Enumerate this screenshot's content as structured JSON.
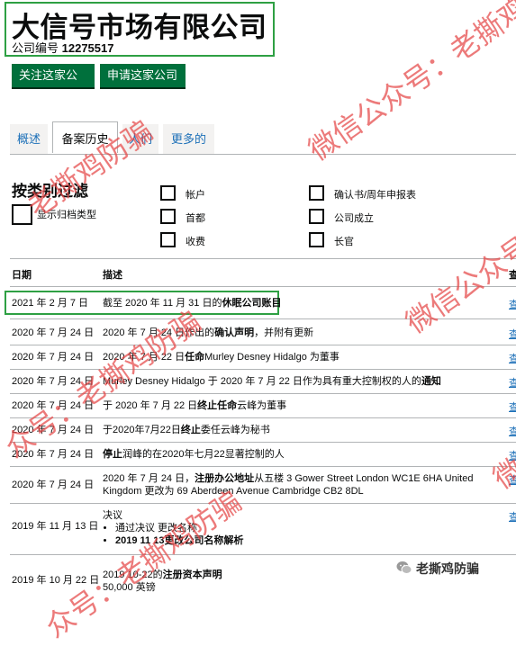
{
  "company": {
    "name": "大信号市场有限公司",
    "number_label": "公司编号",
    "number": "12275517"
  },
  "actions": {
    "follow": "关注这家公司",
    "apply": "申请这家公司"
  },
  "tabs": [
    "概述",
    "备案历史",
    "人们",
    "更多的"
  ],
  "filter": {
    "title": "按类别过滤",
    "show_filing_types": "显示归档类型",
    "options": [
      "帐户",
      "首都",
      "收费",
      "确认书/周年申报表",
      "公司成立",
      "长官"
    ]
  },
  "table": {
    "headers": [
      "日期",
      "描述"
    ],
    "rows": [
      {
        "date": "2021 年 2 月 7 日",
        "pre": "截至 2020 年 11 月 31 日的",
        "bold": "休眠公司账目",
        "post": ""
      },
      {
        "date": "2020 年 7 月 24 日",
        "pre": "2020 年 7 月 24 日作出的",
        "bold": "确认声明",
        "post": "，并附有更新"
      },
      {
        "date": "2020 年 7 月 24 日",
        "pre": "2020 年 7 月 22 日",
        "bold": "任命",
        "post": "Murley Desney Hidalgo 为董事"
      },
      {
        "date": "2020 年 7 月 24 日",
        "pre": "Murley Desney Hidalgo 于 2020 年 7 月 22 日作为具有重大控制权的人的",
        "bold": "通知",
        "post": ""
      },
      {
        "date": "2020 年 7 月 24 日",
        "pre": "于 2020 年 7 月 22 日",
        "bold": "终止任命",
        "post": "云峰为董事"
      },
      {
        "date": "2020 年 7 月 24 日",
        "pre": "于2020年7月22日",
        "bold": "终止",
        "post": "委任云峰为秘书"
      },
      {
        "date": "2020 年 7 月 24 日",
        "pre": "",
        "bold": "停止",
        "post": "润峰的在2020年七月22显著控制的人"
      },
      {
        "date": "2020 年 7 月 24 日",
        "pre": "2020 年 7 月 24 日，",
        "bold": "注册办公地址",
        "post": "从五楼 3 Gower Street London WC1E 6HA United Kingdom 更改为 69 Aberdeen Avenue Cambridge CB2 8DL"
      },
      {
        "date": "2019 年 11 月 13 日",
        "pre": "决议",
        "bullets": [
          "通过决议 更改名称",
          "2019 11 13更改公司名称解析"
        ]
      },
      {
        "date": "2019 年 10 月 22 日",
        "pre": "2019 10-22的",
        "bold": "注册资本声明",
        "extra": "50,000 英镑"
      }
    ],
    "view_label": "查"
  },
  "watermarks": [
    "微信公众号：老撕鸡防骗",
    "老撕鸡防骗",
    "微信公众号：老撕鸡防骗",
    "众号：老撕鸡防骗",
    "众号：老撕鸡防骗",
    "微信",
    "众号：老撕鸡防骗"
  ],
  "wechat_badge": "老撕鸡防骗"
}
